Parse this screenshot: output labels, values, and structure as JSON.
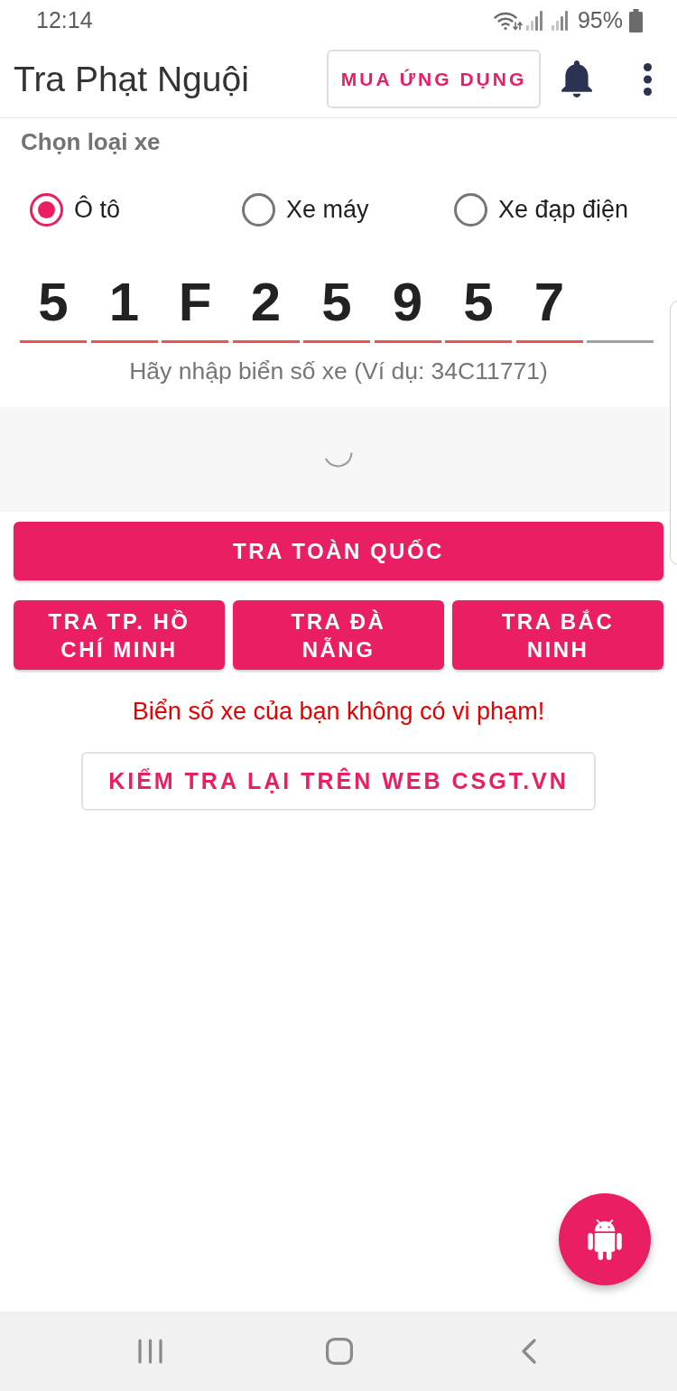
{
  "status_bar": {
    "time": "12:14",
    "battery": "95%"
  },
  "app_bar": {
    "title": "Tra Phạt Nguội",
    "buy_button": "MUA ỨNG DỤNG"
  },
  "vehicle_type": {
    "heading": "Chọn loại xe",
    "options": [
      {
        "label": "Ô tô",
        "selected": true
      },
      {
        "label": "Xe máy",
        "selected": false
      },
      {
        "label": "Xe đạp điện",
        "selected": false
      }
    ]
  },
  "plate": {
    "cells": [
      {
        "char": "5",
        "filled": true
      },
      {
        "char": "1",
        "filled": true
      },
      {
        "char": "F",
        "filled": true
      },
      {
        "char": "2",
        "filled": true
      },
      {
        "char": "5",
        "filled": true
      },
      {
        "char": "9",
        "filled": true
      },
      {
        "char": "5",
        "filled": true
      },
      {
        "char": "7",
        "filled": true
      },
      {
        "filled": false
      }
    ],
    "hint": "Hãy nhập biển số xe (Ví dụ: 34C11771)"
  },
  "ad_area": {
    "loading": true
  },
  "search_buttons": {
    "nationwide": "TRA TOÀN QUỐC",
    "regional": [
      "TRA TP. HỒ CHÍ MINH",
      "TRA ĐÀ NẴNG",
      "TRA BẮC NINH"
    ]
  },
  "result_message": "Biển số xe của bạn không có vi phạm!",
  "recheck_button": "KIỂM TRA LẠI TRÊN WEB CSGT.VN"
}
